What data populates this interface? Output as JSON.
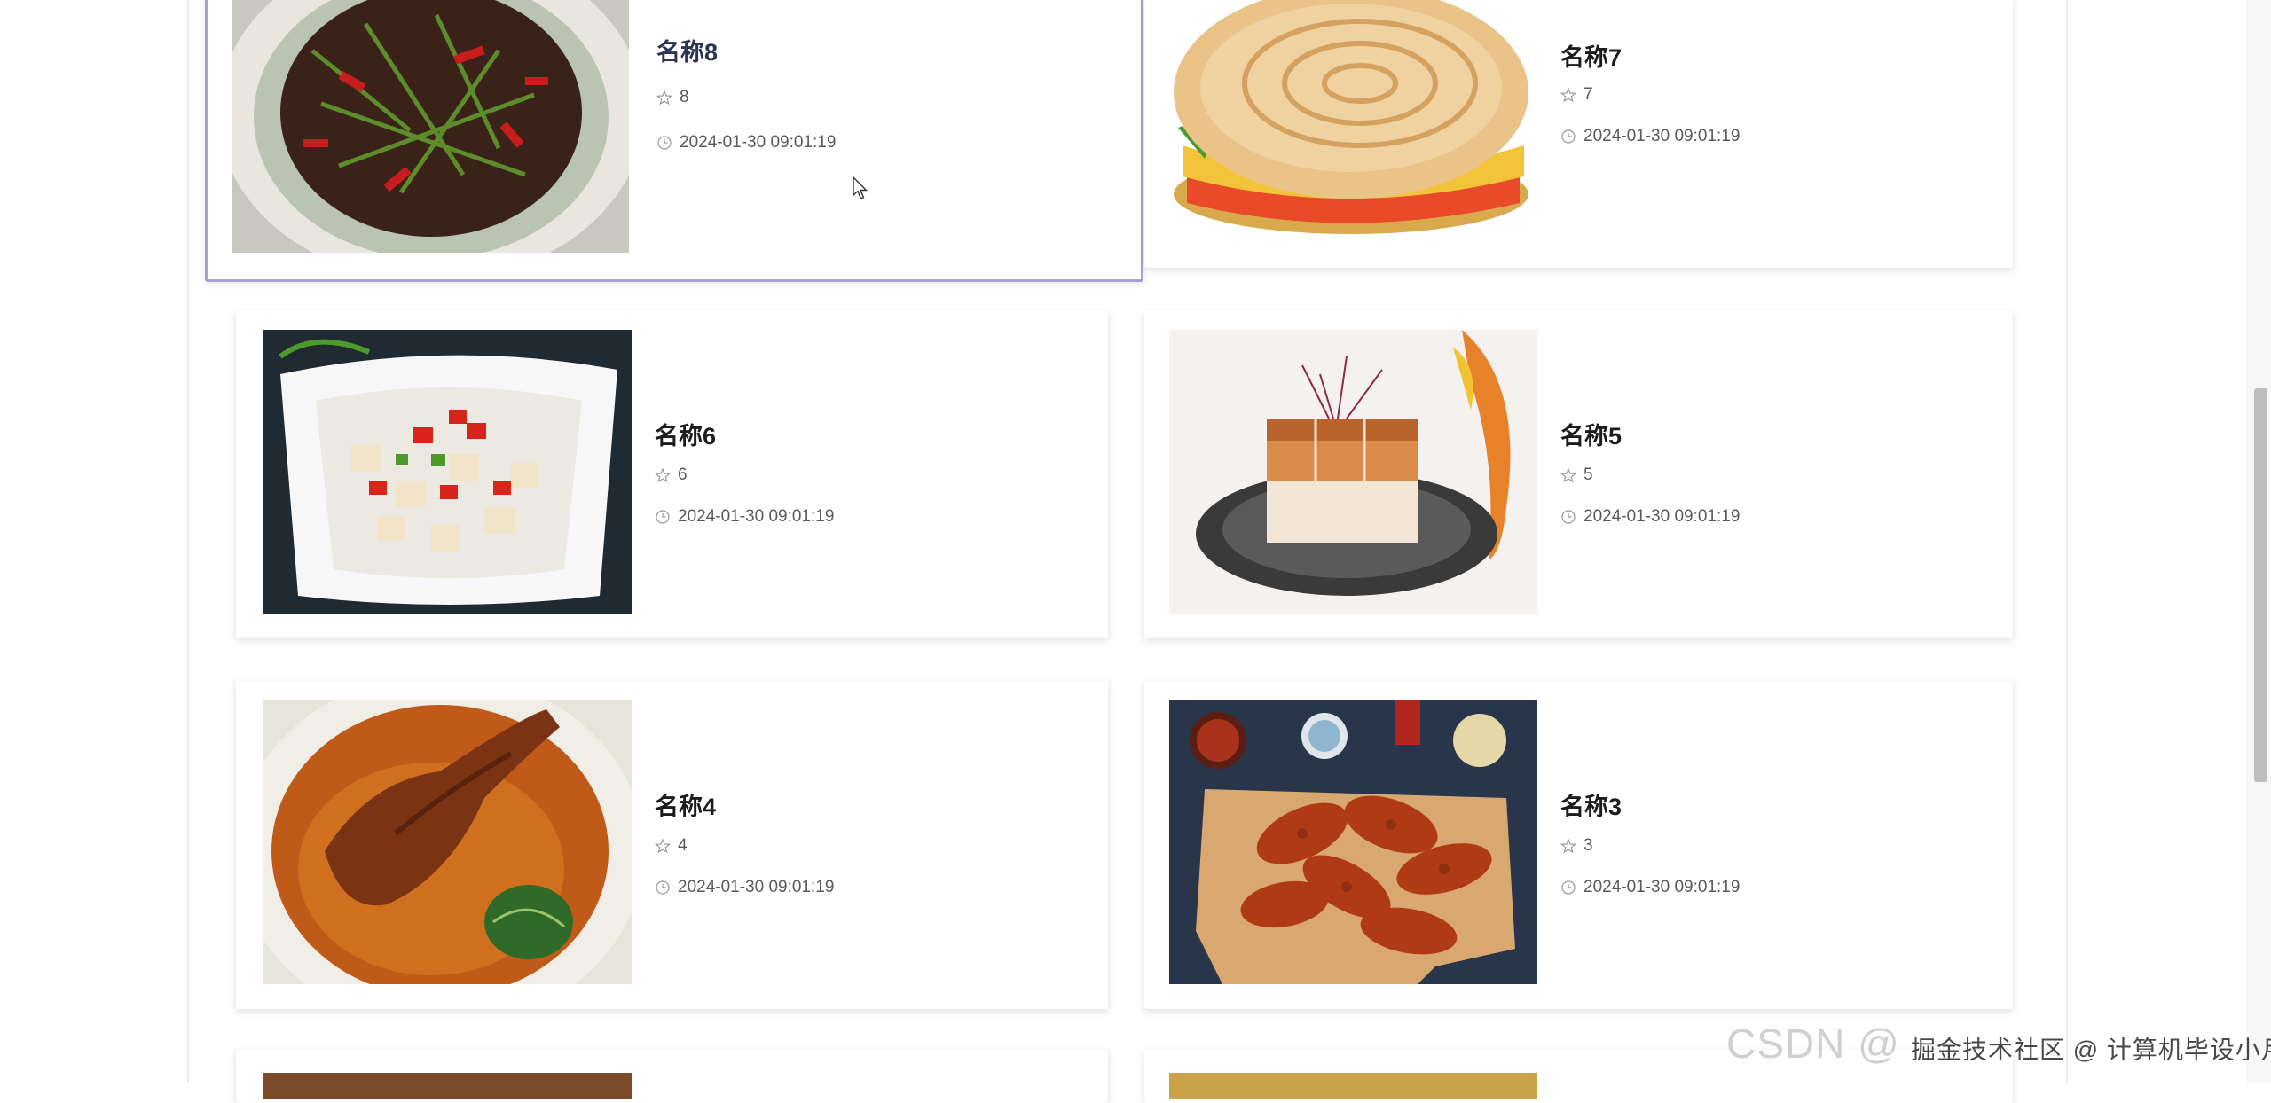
{
  "cards": [
    {
      "title": "名称8",
      "likes": "8",
      "time": "2024-01-30 09:01:19",
      "image": "stir-fried-beef-with-peppers"
    },
    {
      "title": "名称7",
      "likes": "7",
      "time": "2024-01-30 09:01:19",
      "image": "flatbread-sandwich"
    },
    {
      "title": "名称6",
      "likes": "6",
      "time": "2024-01-30 09:01:19",
      "image": "spicy-lotus-root"
    },
    {
      "title": "名称5",
      "likes": "5",
      "time": "2024-01-30 09:01:19",
      "image": "crispy-pork-belly"
    },
    {
      "title": "名称4",
      "likes": "4",
      "time": "2024-01-30 09:01:19",
      "image": "braised-duck-feet"
    },
    {
      "title": "名称3",
      "likes": "3",
      "time": "2024-01-30 09:01:19",
      "image": "grilled-chicken-wings"
    }
  ],
  "icons": {
    "likes": "star-icon",
    "time": "clock-icon"
  },
  "colors": {
    "active_border": "#a7a1d8",
    "title": "#1c1c1c",
    "meta_text": "#5a5a5a"
  },
  "watermark": {
    "main": "CSDN @",
    "sub": "掘金技术社区 @ 计算机毕设小月哥"
  }
}
